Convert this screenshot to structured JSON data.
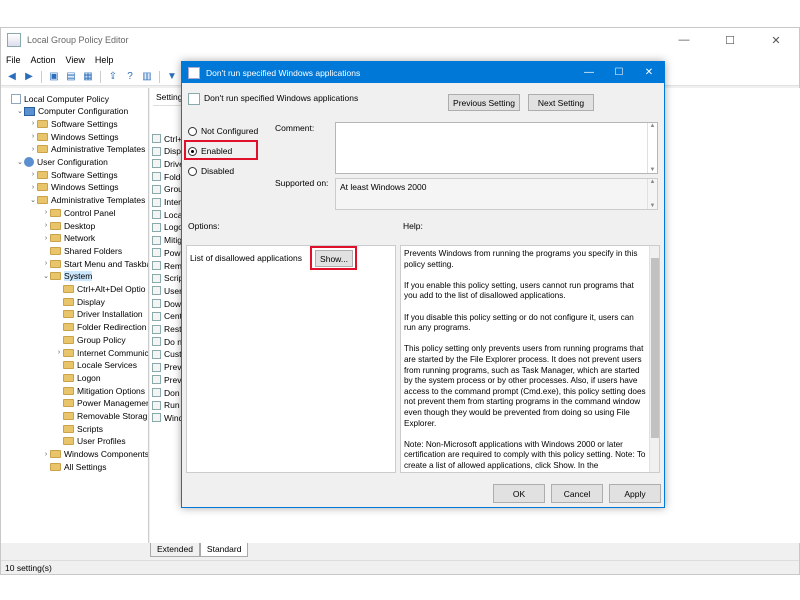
{
  "app": {
    "title": "Local Group Policy Editor",
    "controls": [
      "—",
      "☐",
      "✕"
    ],
    "menu": [
      "File",
      "Action",
      "View",
      "Help"
    ]
  },
  "tree": {
    "items": [
      {
        "label": "Local Computer Policy",
        "icon": "doc",
        "indent": 0,
        "twisty": ""
      },
      {
        "label": "Computer Configuration",
        "icon": "pc",
        "indent": 1,
        "twisty": "⌄"
      },
      {
        "label": "Software Settings",
        "icon": "folder",
        "indent": 2,
        "twisty": "›"
      },
      {
        "label": "Windows Settings",
        "icon": "folder",
        "indent": 2,
        "twisty": "›"
      },
      {
        "label": "Administrative Templates",
        "icon": "folder",
        "indent": 2,
        "twisty": "›"
      },
      {
        "label": "User Configuration",
        "icon": "user",
        "indent": 1,
        "twisty": "⌄"
      },
      {
        "label": "Software Settings",
        "icon": "folder",
        "indent": 2,
        "twisty": "›"
      },
      {
        "label": "Windows Settings",
        "icon": "folder",
        "indent": 2,
        "twisty": "›"
      },
      {
        "label": "Administrative Templates",
        "icon": "folder",
        "indent": 2,
        "twisty": "⌄"
      },
      {
        "label": "Control Panel",
        "icon": "folder",
        "indent": 3,
        "twisty": "›"
      },
      {
        "label": "Desktop",
        "icon": "folder",
        "indent": 3,
        "twisty": "›"
      },
      {
        "label": "Network",
        "icon": "folder",
        "indent": 3,
        "twisty": "›"
      },
      {
        "label": "Shared Folders",
        "icon": "folder",
        "indent": 3,
        "twisty": ""
      },
      {
        "label": "Start Menu and Taskba",
        "icon": "folder",
        "indent": 3,
        "twisty": "›"
      },
      {
        "label": "System",
        "icon": "folder",
        "indent": 3,
        "twisty": "⌄"
      },
      {
        "label": "Ctrl+Alt+Del Optio",
        "icon": "folder",
        "indent": 4,
        "twisty": ""
      },
      {
        "label": "Display",
        "icon": "folder",
        "indent": 4,
        "twisty": ""
      },
      {
        "label": "Driver Installation",
        "icon": "folder",
        "indent": 4,
        "twisty": ""
      },
      {
        "label": "Folder Redirection",
        "icon": "folder",
        "indent": 4,
        "twisty": ""
      },
      {
        "label": "Group Policy",
        "icon": "folder",
        "indent": 4,
        "twisty": ""
      },
      {
        "label": "Internet Communic",
        "icon": "folder",
        "indent": 4,
        "twisty": "›"
      },
      {
        "label": "Locale Services",
        "icon": "folder",
        "indent": 4,
        "twisty": ""
      },
      {
        "label": "Logon",
        "icon": "folder",
        "indent": 4,
        "twisty": ""
      },
      {
        "label": "Mitigation Options",
        "icon": "folder",
        "indent": 4,
        "twisty": ""
      },
      {
        "label": "Power Managemer",
        "icon": "folder",
        "indent": 4,
        "twisty": ""
      },
      {
        "label": "Removable Storag",
        "icon": "folder",
        "indent": 4,
        "twisty": ""
      },
      {
        "label": "Scripts",
        "icon": "folder",
        "indent": 4,
        "twisty": ""
      },
      {
        "label": "User Profiles",
        "icon": "folder",
        "indent": 4,
        "twisty": ""
      },
      {
        "label": "Windows Components",
        "icon": "folder",
        "indent": 3,
        "twisty": "›"
      },
      {
        "label": "All Settings",
        "icon": "folder",
        "indent": 3,
        "twisty": ""
      }
    ]
  },
  "list": {
    "header": "Setting",
    "items": [
      "Ctrl+",
      "Disp",
      "Drive",
      "Folde",
      "Grou",
      "Interr",
      "Loca",
      "Logo",
      "Mitig",
      "Powe",
      "Rem",
      "Scrip",
      "User",
      "Dow",
      "Cent",
      "Rest",
      "Do n",
      "Cust",
      "Prev",
      "Prev",
      "Don",
      "Run",
      "Wind"
    ]
  },
  "tabs": [
    "Extended",
    "Standard"
  ],
  "status": "10 setting(s)",
  "dialog": {
    "title": "Don't run specified Windows applications",
    "setting_name": "Don't run specified Windows applications",
    "prev_button": "Previous Setting",
    "next_button": "Next Setting",
    "radios": {
      "not_configured": "Not Configured",
      "enabled": "Enabled",
      "disabled": "Disabled"
    },
    "selected": "enabled",
    "comment_label": "Comment:",
    "supported_label": "Supported on:",
    "supported_value": "At least Windows 2000",
    "options_label": "Options:",
    "help_label": "Help:",
    "option_text": "List of disallowed applications",
    "show_button": "Show...",
    "help_paragraphs": [
      "Prevents Windows from running the programs you specify in this policy setting.",
      "If you enable this policy setting, users cannot run programs that you add to the list of disallowed applications.",
      "If you disable this policy setting or do not configure it, users can run any programs.",
      "This policy setting only prevents users from running programs that are started by the File Explorer process. It does not prevent users from running programs, such as Task Manager, which are started by the system process or by other processes.  Also, if users have access to the command prompt (Cmd.exe), this policy setting does not prevent them from starting programs in the command window even though they would be prevented from doing so using File Explorer.",
      "Note: Non-Microsoft applications with Windows 2000 or later certification are required to comply with this policy setting. Note: To create a list of allowed applications, click Show.  In the"
    ],
    "ok": "OK",
    "cancel": "Cancel",
    "apply": "Apply"
  }
}
